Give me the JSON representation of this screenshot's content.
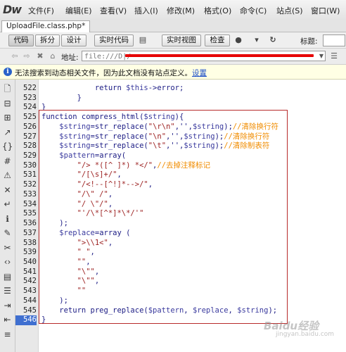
{
  "app": {
    "logo": "Dw"
  },
  "menu": [
    "文件(F)",
    "编辑(E)",
    "查看(V)",
    "插入(I)",
    "修改(M)",
    "格式(O)",
    "命令(C)",
    "站点(S)",
    "窗口(W)"
  ],
  "document_tab": "UploadFile.class.php*",
  "toolbar": {
    "code_btn": "代码",
    "split_btn": "拆分",
    "design_btn": "设计",
    "live_code_btn": "实时代码",
    "live_view_btn": "实时视图",
    "inspect_btn": "检查",
    "title_label": "标题:",
    "title_value": ""
  },
  "address_bar": {
    "label": "地址:",
    "value": "file:///D|/"
  },
  "infobar": {
    "text": "无法搜索到动态相关文件，因为此文档没有站点定义。",
    "link": "设置"
  },
  "line_numbers": [
    "522",
    "523",
    "524",
    "525",
    "526",
    "527",
    "528",
    "529",
    "530",
    "531",
    "532",
    "533",
    "534",
    "535",
    "536",
    "537",
    "538",
    "539",
    "540",
    "541",
    "542",
    "543",
    "544",
    "545",
    "546"
  ],
  "selected_line": "546",
  "code_lines": [
    [
      {
        "t": "            return ",
        "c": "kw"
      },
      {
        "t": "$this",
        "c": "var"
      },
      {
        "t": "->error;",
        "c": "kw"
      }
    ],
    [
      {
        "t": "        }",
        "c": "kw"
      }
    ],
    [
      {
        "t": "}",
        "c": "kw"
      }
    ],
    [
      {
        "t": "function compress_html(",
        "c": "kw"
      },
      {
        "t": "$string",
        "c": "var"
      },
      {
        "t": "){",
        "c": "kw"
      }
    ],
    [
      {
        "t": "    ",
        "c": "kw"
      },
      {
        "t": "$string",
        "c": "var"
      },
      {
        "t": "=str_replace(",
        "c": "kw"
      },
      {
        "t": "\"\\r\\n\"",
        "c": "str"
      },
      {
        "t": ",'',",
        "c": "kw"
      },
      {
        "t": "$string",
        "c": "var"
      },
      {
        "t": ");",
        "c": "kw"
      },
      {
        "t": "//清除换行符",
        "c": "cmt"
      }
    ],
    [
      {
        "t": "    ",
        "c": "kw"
      },
      {
        "t": "$string",
        "c": "var"
      },
      {
        "t": "=str_replace(",
        "c": "kw"
      },
      {
        "t": "\"\\n\"",
        "c": "str"
      },
      {
        "t": ",'',",
        "c": "kw"
      },
      {
        "t": "$string",
        "c": "var"
      },
      {
        "t": ");",
        "c": "kw"
      },
      {
        "t": "//清除换行符",
        "c": "cmt"
      }
    ],
    [
      {
        "t": "    ",
        "c": "kw"
      },
      {
        "t": "$string",
        "c": "var"
      },
      {
        "t": "=str_replace(",
        "c": "kw"
      },
      {
        "t": "\"\\t\"",
        "c": "str"
      },
      {
        "t": ",'',",
        "c": "kw"
      },
      {
        "t": "$string",
        "c": "var"
      },
      {
        "t": ");",
        "c": "kw"
      },
      {
        "t": "//清除制表符",
        "c": "cmt"
      }
    ],
    [
      {
        "t": "    ",
        "c": "kw"
      },
      {
        "t": "$pattern",
        "c": "var"
      },
      {
        "t": "=array(",
        "c": "kw"
      }
    ],
    [
      {
        "t": "        ",
        "c": "kw"
      },
      {
        "t": "\"/> *([^ ]*) *</\"",
        "c": "str"
      },
      {
        "t": ",",
        "c": "kw"
      },
      {
        "t": "//去掉注释标记",
        "c": "cmt"
      }
    ],
    [
      {
        "t": "        ",
        "c": "kw"
      },
      {
        "t": "\"/[\\s]+/\"",
        "c": "str"
      },
      {
        "t": ",",
        "c": "kw"
      }
    ],
    [
      {
        "t": "        ",
        "c": "kw"
      },
      {
        "t": "\"/<!--[^!]*-->/\"",
        "c": "str"
      },
      {
        "t": ",",
        "c": "kw"
      }
    ],
    [
      {
        "t": "        ",
        "c": "kw"
      },
      {
        "t": "\"/\\\" /\"",
        "c": "str"
      },
      {
        "t": ",",
        "c": "kw"
      }
    ],
    [
      {
        "t": "        ",
        "c": "kw"
      },
      {
        "t": "\"/ \\\"/\"",
        "c": "str"
      },
      {
        "t": ",",
        "c": "kw"
      }
    ],
    [
      {
        "t": "        ",
        "c": "kw"
      },
      {
        "t": "\"'/\\*[^*]*\\*/'\"",
        "c": "str"
      }
    ],
    [
      {
        "t": "    );",
        "c": "kw"
      }
    ],
    [
      {
        "t": "    ",
        "c": "kw"
      },
      {
        "t": "$replace",
        "c": "var"
      },
      {
        "t": "=array (",
        "c": "kw"
      }
    ],
    [
      {
        "t": "        ",
        "c": "kw"
      },
      {
        "t": "\">\\\\1<\"",
        "c": "str"
      },
      {
        "t": ",",
        "c": "kw"
      }
    ],
    [
      {
        "t": "        ",
        "c": "kw"
      },
      {
        "t": "\" \"",
        "c": "str"
      },
      {
        "t": ",",
        "c": "kw"
      }
    ],
    [
      {
        "t": "        ",
        "c": "kw"
      },
      {
        "t": "\"\"",
        "c": "str"
      },
      {
        "t": ",",
        "c": "kw"
      }
    ],
    [
      {
        "t": "        ",
        "c": "kw"
      },
      {
        "t": "\"\\\"\"",
        "c": "str"
      },
      {
        "t": ",",
        "c": "kw"
      }
    ],
    [
      {
        "t": "        ",
        "c": "kw"
      },
      {
        "t": "\"\\\"\"",
        "c": "str"
      },
      {
        "t": ",",
        "c": "kw"
      }
    ],
    [
      {
        "t": "        ",
        "c": "kw"
      },
      {
        "t": "\"\"",
        "c": "str"
      }
    ],
    [
      {
        "t": "    );",
        "c": "kw"
      }
    ],
    [
      {
        "t": "    return preg_replace(",
        "c": "kw"
      },
      {
        "t": "$pattern",
        "c": "var"
      },
      {
        "t": ", ",
        "c": "kw"
      },
      {
        "t": "$replace",
        "c": "var"
      },
      {
        "t": ", ",
        "c": "kw"
      },
      {
        "t": "$string",
        "c": "var"
      },
      {
        "t": ");",
        "c": "kw"
      }
    ],
    [
      {
        "t": "}",
        "c": "kw"
      }
    ]
  ],
  "watermark": {
    "logo": "Baidu经验",
    "url": "jingyan.baidu.com"
  },
  "colors": {
    "selected_line": "#3f6fd0",
    "comment": "#f08c00",
    "string": "#9b1f1f",
    "highlight_box": "#b72b2b",
    "redaction": "#e60000"
  },
  "left_icons": [
    "file-icon",
    "collapse-icon",
    "expand-icon",
    "select-parent-icon",
    "balance-braces-icon",
    "line-numbers-icon",
    "highlight-invalid-icon",
    "syntax-error-icon",
    "word-wrap-icon",
    "info-icon",
    "comment-icon",
    "uncomment-icon",
    "wrap-tag-icon",
    "recent-snippets-icon",
    "move-css-icon",
    "indent-icon",
    "outdent-icon",
    "format-icon"
  ]
}
